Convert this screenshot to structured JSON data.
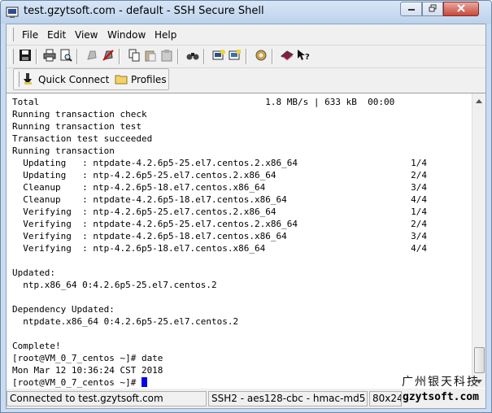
{
  "window": {
    "title": "test.gzytsoft.com - default - SSH Secure Shell"
  },
  "menu": [
    "File",
    "Edit",
    "View",
    "Window",
    "Help"
  ],
  "toolbar": {
    "icons": [
      "save-icon",
      "print-icon",
      "print-preview-icon",
      "disconnect-icon",
      "reconnect-icon",
      "copy-icon",
      "paste-icon",
      "paste-alt-icon",
      "find-icon",
      "new-terminal-icon",
      "new-file-transfer-icon",
      "settings-icon",
      "help-topics-icon",
      "context-help-icon"
    ]
  },
  "profilebar": {
    "quick_connect": "Quick Connect",
    "profiles": "Profiles"
  },
  "terminal": {
    "lines": [
      "Total                                          1.8 MB/s | 633 kB  00:00",
      "Running transaction check",
      "Running transaction test",
      "Transaction test succeeded",
      "Running transaction",
      "  Updating   : ntpdate-4.2.6p5-25.el7.centos.2.x86_64                     1/4",
      "  Updating   : ntp-4.2.6p5-25.el7.centos.2.x86_64                         2/4",
      "  Cleanup    : ntp-4.2.6p5-18.el7.centos.x86_64                           3/4",
      "  Cleanup    : ntpdate-4.2.6p5-18.el7.centos.x86_64                       4/4",
      "  Verifying  : ntp-4.2.6p5-25.el7.centos.2.x86_64                         1/4",
      "  Verifying  : ntpdate-4.2.6p5-25.el7.centos.2.x86_64                     2/4",
      "  Verifying  : ntpdate-4.2.6p5-18.el7.centos.x86_64                       3/4",
      "  Verifying  : ntp-4.2.6p5-18.el7.centos.x86_64                           4/4",
      "",
      "Updated:",
      "  ntp.x86_64 0:4.2.6p5-25.el7.centos.2",
      "",
      "Dependency Updated:",
      "  ntpdate.x86_64 0:4.2.6p5-25.el7.centos.2",
      "",
      "Complete!",
      "[root@VM_0_7_centos ~]# date",
      "Mon Mar 12 10:36:24 CST 2018"
    ],
    "prompt": "[root@VM_0_7_centos ~]# "
  },
  "status": {
    "connection": "Connected to test.gzytsoft.com",
    "crypto": "SSH2 - aes128-cbc - hmac-md5",
    "size": "80x24"
  },
  "watermark": {
    "company": "广州银天科技",
    "url": "gzytsoft.com"
  }
}
